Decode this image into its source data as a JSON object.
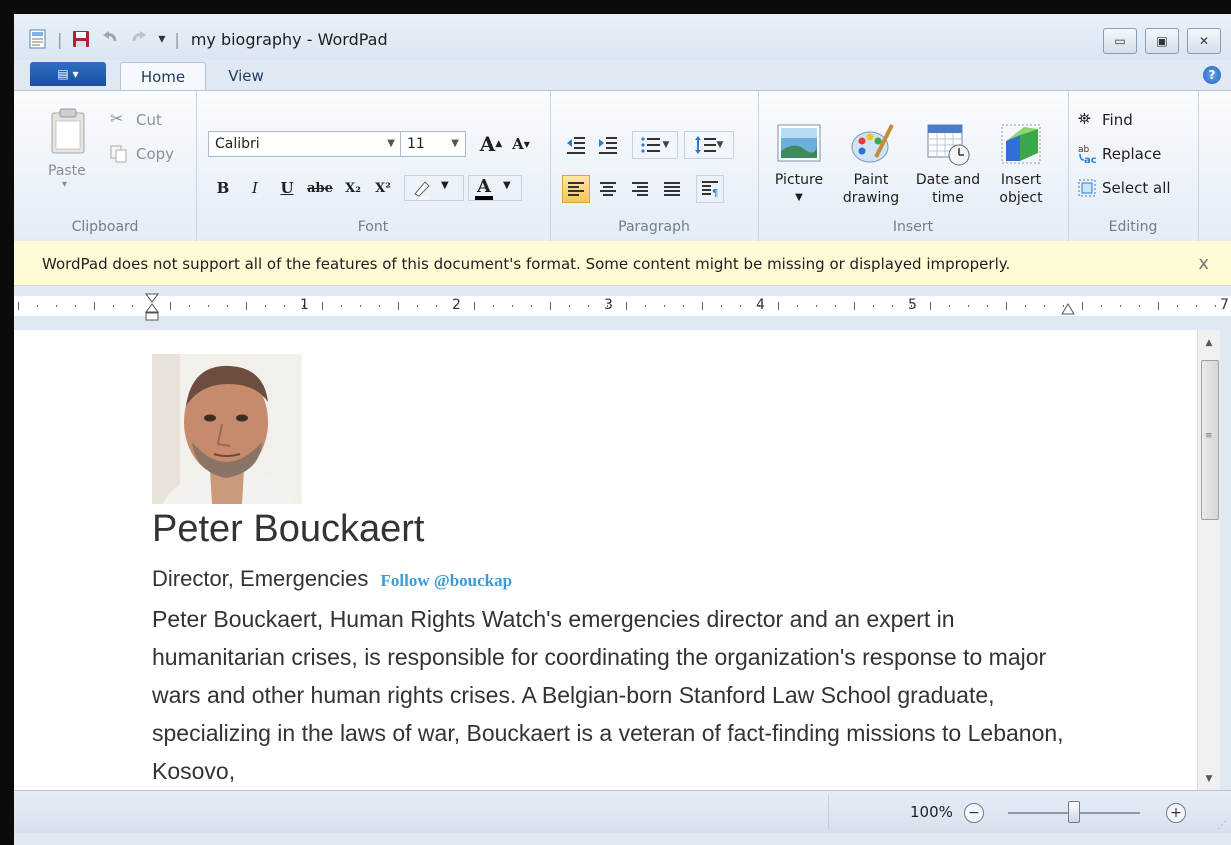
{
  "window": {
    "title": "my biography - WordPad",
    "separator": "|",
    "qat_dropdown": "▾"
  },
  "tabs": {
    "app_menu": "▤ ▾",
    "home": "Home",
    "view": "View",
    "help": "?"
  },
  "clipboard": {
    "paste": "Paste",
    "cut": "Cut",
    "copy": "Copy",
    "group": "Clipboard"
  },
  "font": {
    "family": "Calibri",
    "size": "11",
    "grow": "A",
    "shrink": "A",
    "bold": "B",
    "italic": "I",
    "underline": "U",
    "strike": "abe",
    "subscript": "X₂",
    "superscript": "X²",
    "color": "A",
    "group": "Font"
  },
  "paragraph": {
    "group": "Paragraph",
    "active_alignment": "left"
  },
  "insert": {
    "picture": "Picture",
    "paint_line1": "Paint",
    "paint_line2": "drawing",
    "date_line1": "Date and",
    "date_line2": "time",
    "object_line1": "Insert",
    "object_line2": "object",
    "group": "Insert"
  },
  "editing": {
    "find": "Find",
    "replace": "Replace",
    "select_all": "Select all",
    "group": "Editing"
  },
  "infobar": {
    "message": "WordPad does not support all of the features of this document's format. Some content might be missing or displayed improperly.",
    "close": "x"
  },
  "ruler": {
    "numbers": [
      "1",
      "2",
      "3",
      "4",
      "5",
      "7"
    ]
  },
  "document": {
    "name": "Peter Bouckaert",
    "role": "Director, Emergencies",
    "follow": "Follow @bouckap",
    "bio": "Peter Bouckaert, Human Rights Watch's emergencies director and an expert in humanitarian crises, is responsible for coordinating the organization's response to major wars and other human rights crises. A Belgian-born Stanford Law School graduate, specializing in the laws of war, Bouckaert is a veteran of fact-finding missions to Lebanon, Kosovo,"
  },
  "statusbar": {
    "zoom": "100%",
    "zoom_level_percent": 100
  },
  "colors": {
    "accent": "#1a4f9e",
    "link": "#3a9bd6",
    "infobar_bg": "#fefbd6"
  }
}
